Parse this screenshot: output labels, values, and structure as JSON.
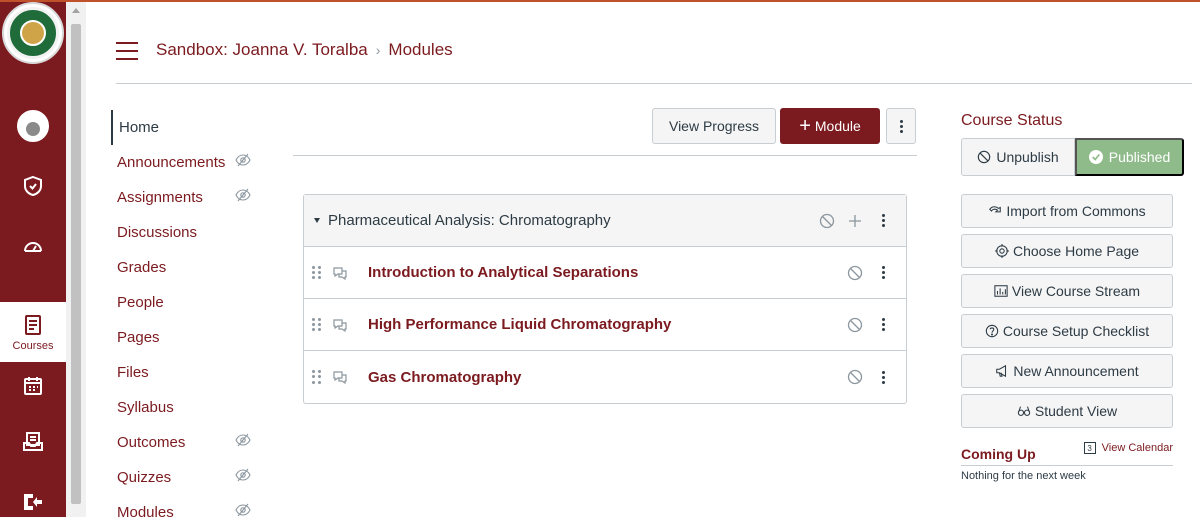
{
  "global_nav": {
    "items": [
      {
        "id": "account",
        "icon": "avatar-icon"
      },
      {
        "id": "admin",
        "icon": "shield-icon"
      },
      {
        "id": "dashboard",
        "icon": "dashboard-icon"
      },
      {
        "id": "courses",
        "icon": "courses-icon",
        "label": "Courses",
        "active": true
      },
      {
        "id": "calendar",
        "icon": "calendar-icon"
      },
      {
        "id": "inbox",
        "icon": "inbox-icon"
      },
      {
        "id": "logout",
        "icon": "logout-icon"
      }
    ]
  },
  "header": {
    "course": "Sandbox: Joanna V. Toralba",
    "separator": "›",
    "current": "Modules"
  },
  "course_nav": {
    "items": [
      {
        "label": "Home",
        "active": true,
        "hidden": false
      },
      {
        "label": "Announcements",
        "hidden": true
      },
      {
        "label": "Assignments",
        "hidden": true
      },
      {
        "label": "Discussions",
        "hidden": false
      },
      {
        "label": "Grades",
        "hidden": false
      },
      {
        "label": "People",
        "hidden": false
      },
      {
        "label": "Pages",
        "hidden": false
      },
      {
        "label": "Files",
        "hidden": false
      },
      {
        "label": "Syllabus",
        "hidden": false
      },
      {
        "label": "Outcomes",
        "hidden": true
      },
      {
        "label": "Quizzes",
        "hidden": true
      },
      {
        "label": "Modules",
        "hidden": true
      }
    ]
  },
  "toolbar": {
    "view_progress": "View Progress",
    "add_module_plus": "+",
    "add_module": "Module"
  },
  "module": {
    "title": "Pharmaceutical Analysis: Chromatography",
    "items": [
      {
        "title": "Introduction to Analytical Separations"
      },
      {
        "title": "High Performance Liquid Chromatography"
      },
      {
        "title": "Gas Chromatography"
      }
    ]
  },
  "sidebar": {
    "course_status": "Course Status",
    "unpublish": "Unpublish",
    "published": "Published",
    "buttons": [
      {
        "label": "Import from Commons",
        "icon": "import-icon"
      },
      {
        "label": "Choose Home Page",
        "icon": "target-icon"
      },
      {
        "label": "View Course Stream",
        "icon": "stream-icon"
      },
      {
        "label": "Course Setup Checklist",
        "icon": "question-icon"
      },
      {
        "label": "New Announcement",
        "icon": "megaphone-icon"
      },
      {
        "label": "Student View",
        "icon": "glasses-icon"
      }
    ],
    "coming_up": "Coming Up",
    "view_calendar": "View Calendar",
    "calendar_day": "3",
    "nothing": "Nothing for the next week"
  },
  "colors": {
    "brand": "#7b1a1f",
    "published": "#8fbb8a",
    "text": "#2d3b45",
    "border": "#c7cdd1"
  }
}
